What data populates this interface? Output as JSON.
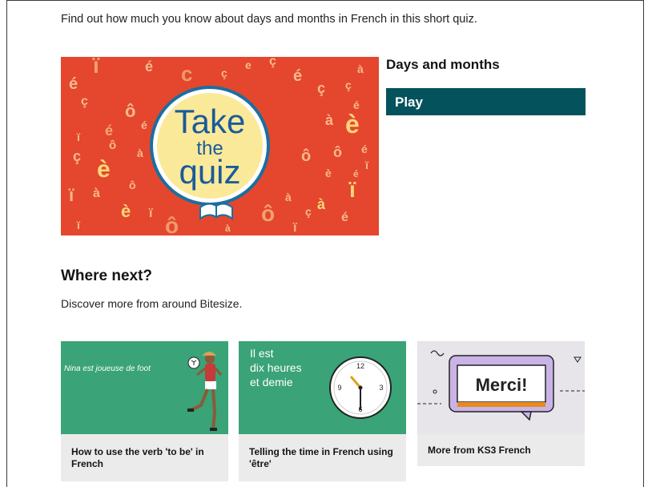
{
  "intro": "Find out how much you know about days and months in French in this short quiz.",
  "quiz": {
    "title": "Days and months",
    "play_label": "Play",
    "image": {
      "line1": "Take",
      "line2": "the",
      "line3": "quiz",
      "glyphs": [
        "ç",
        "è",
        "é",
        "à",
        "ô",
        "ï"
      ]
    }
  },
  "where_next": {
    "heading": "Where next?",
    "subtitle": "Discover more from around Bitesize.",
    "cards": [
      {
        "caption": "How to use the verb 'to be' in French",
        "thumb_text": "Nina est joueuse de foot"
      },
      {
        "caption": "Telling the time in French using 'être'",
        "thumb_line1": "Il est",
        "thumb_line2": "dix heures",
        "thumb_line3": "et demie"
      },
      {
        "caption": "More from KS3 French",
        "thumb_text": "Merci!"
      }
    ]
  },
  "colors": {
    "play_bg": "#03525c",
    "quiz_red": "#e4472d",
    "card_green": "#3aa377",
    "card_bg": "#ebebeb"
  }
}
